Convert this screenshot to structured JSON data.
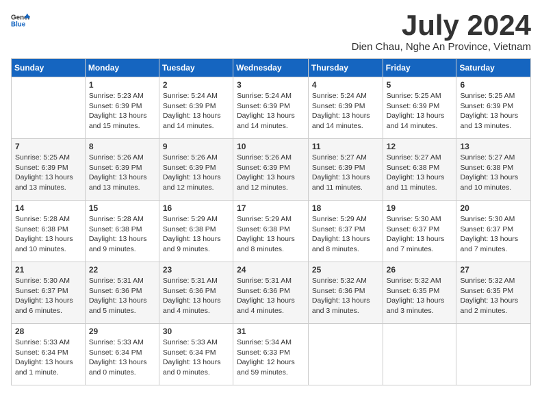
{
  "header": {
    "logo_line1": "General",
    "logo_line2": "Blue",
    "month_title": "July 2024",
    "location": "Dien Chau, Nghe An Province, Vietnam"
  },
  "columns": [
    "Sunday",
    "Monday",
    "Tuesday",
    "Wednesday",
    "Thursday",
    "Friday",
    "Saturday"
  ],
  "weeks": [
    [
      {
        "day": "",
        "sunrise": "",
        "sunset": "",
        "daylight": ""
      },
      {
        "day": "1",
        "sunrise": "Sunrise: 5:23 AM",
        "sunset": "Sunset: 6:39 PM",
        "daylight": "Daylight: 13 hours and 15 minutes."
      },
      {
        "day": "2",
        "sunrise": "Sunrise: 5:24 AM",
        "sunset": "Sunset: 6:39 PM",
        "daylight": "Daylight: 13 hours and 14 minutes."
      },
      {
        "day": "3",
        "sunrise": "Sunrise: 5:24 AM",
        "sunset": "Sunset: 6:39 PM",
        "daylight": "Daylight: 13 hours and 14 minutes."
      },
      {
        "day": "4",
        "sunrise": "Sunrise: 5:24 AM",
        "sunset": "Sunset: 6:39 PM",
        "daylight": "Daylight: 13 hours and 14 minutes."
      },
      {
        "day": "5",
        "sunrise": "Sunrise: 5:25 AM",
        "sunset": "Sunset: 6:39 PM",
        "daylight": "Daylight: 13 hours and 14 minutes."
      },
      {
        "day": "6",
        "sunrise": "Sunrise: 5:25 AM",
        "sunset": "Sunset: 6:39 PM",
        "daylight": "Daylight: 13 hours and 13 minutes."
      }
    ],
    [
      {
        "day": "7",
        "sunrise": "Sunrise: 5:25 AM",
        "sunset": "Sunset: 6:39 PM",
        "daylight": "Daylight: 13 hours and 13 minutes."
      },
      {
        "day": "8",
        "sunrise": "Sunrise: 5:26 AM",
        "sunset": "Sunset: 6:39 PM",
        "daylight": "Daylight: 13 hours and 13 minutes."
      },
      {
        "day": "9",
        "sunrise": "Sunrise: 5:26 AM",
        "sunset": "Sunset: 6:39 PM",
        "daylight": "Daylight: 13 hours and 12 minutes."
      },
      {
        "day": "10",
        "sunrise": "Sunrise: 5:26 AM",
        "sunset": "Sunset: 6:39 PM",
        "daylight": "Daylight: 13 hours and 12 minutes."
      },
      {
        "day": "11",
        "sunrise": "Sunrise: 5:27 AM",
        "sunset": "Sunset: 6:39 PM",
        "daylight": "Daylight: 13 hours and 11 minutes."
      },
      {
        "day": "12",
        "sunrise": "Sunrise: 5:27 AM",
        "sunset": "Sunset: 6:38 PM",
        "daylight": "Daylight: 13 hours and 11 minutes."
      },
      {
        "day": "13",
        "sunrise": "Sunrise: 5:27 AM",
        "sunset": "Sunset: 6:38 PM",
        "daylight": "Daylight: 13 hours and 10 minutes."
      }
    ],
    [
      {
        "day": "14",
        "sunrise": "Sunrise: 5:28 AM",
        "sunset": "Sunset: 6:38 PM",
        "daylight": "Daylight: 13 hours and 10 minutes."
      },
      {
        "day": "15",
        "sunrise": "Sunrise: 5:28 AM",
        "sunset": "Sunset: 6:38 PM",
        "daylight": "Daylight: 13 hours and 9 minutes."
      },
      {
        "day": "16",
        "sunrise": "Sunrise: 5:29 AM",
        "sunset": "Sunset: 6:38 PM",
        "daylight": "Daylight: 13 hours and 9 minutes."
      },
      {
        "day": "17",
        "sunrise": "Sunrise: 5:29 AM",
        "sunset": "Sunset: 6:38 PM",
        "daylight": "Daylight: 13 hours and 8 minutes."
      },
      {
        "day": "18",
        "sunrise": "Sunrise: 5:29 AM",
        "sunset": "Sunset: 6:37 PM",
        "daylight": "Daylight: 13 hours and 8 minutes."
      },
      {
        "day": "19",
        "sunrise": "Sunrise: 5:30 AM",
        "sunset": "Sunset: 6:37 PM",
        "daylight": "Daylight: 13 hours and 7 minutes."
      },
      {
        "day": "20",
        "sunrise": "Sunrise: 5:30 AM",
        "sunset": "Sunset: 6:37 PM",
        "daylight": "Daylight: 13 hours and 7 minutes."
      }
    ],
    [
      {
        "day": "21",
        "sunrise": "Sunrise: 5:30 AM",
        "sunset": "Sunset: 6:37 PM",
        "daylight": "Daylight: 13 hours and 6 minutes."
      },
      {
        "day": "22",
        "sunrise": "Sunrise: 5:31 AM",
        "sunset": "Sunset: 6:36 PM",
        "daylight": "Daylight: 13 hours and 5 minutes."
      },
      {
        "day": "23",
        "sunrise": "Sunrise: 5:31 AM",
        "sunset": "Sunset: 6:36 PM",
        "daylight": "Daylight: 13 hours and 4 minutes."
      },
      {
        "day": "24",
        "sunrise": "Sunrise: 5:31 AM",
        "sunset": "Sunset: 6:36 PM",
        "daylight": "Daylight: 13 hours and 4 minutes."
      },
      {
        "day": "25",
        "sunrise": "Sunrise: 5:32 AM",
        "sunset": "Sunset: 6:36 PM",
        "daylight": "Daylight: 13 hours and 3 minutes."
      },
      {
        "day": "26",
        "sunrise": "Sunrise: 5:32 AM",
        "sunset": "Sunset: 6:35 PM",
        "daylight": "Daylight: 13 hours and 3 minutes."
      },
      {
        "day": "27",
        "sunrise": "Sunrise: 5:32 AM",
        "sunset": "Sunset: 6:35 PM",
        "daylight": "Daylight: 13 hours and 2 minutes."
      }
    ],
    [
      {
        "day": "28",
        "sunrise": "Sunrise: 5:33 AM",
        "sunset": "Sunset: 6:34 PM",
        "daylight": "Daylight: 13 hours and 1 minute."
      },
      {
        "day": "29",
        "sunrise": "Sunrise: 5:33 AM",
        "sunset": "Sunset: 6:34 PM",
        "daylight": "Daylight: 13 hours and 0 minutes."
      },
      {
        "day": "30",
        "sunrise": "Sunrise: 5:33 AM",
        "sunset": "Sunset: 6:34 PM",
        "daylight": "Daylight: 13 hours and 0 minutes."
      },
      {
        "day": "31",
        "sunrise": "Sunrise: 5:34 AM",
        "sunset": "Sunset: 6:33 PM",
        "daylight": "Daylight: 12 hours and 59 minutes."
      },
      {
        "day": "",
        "sunrise": "",
        "sunset": "",
        "daylight": ""
      },
      {
        "day": "",
        "sunrise": "",
        "sunset": "",
        "daylight": ""
      },
      {
        "day": "",
        "sunrise": "",
        "sunset": "",
        "daylight": ""
      }
    ]
  ]
}
